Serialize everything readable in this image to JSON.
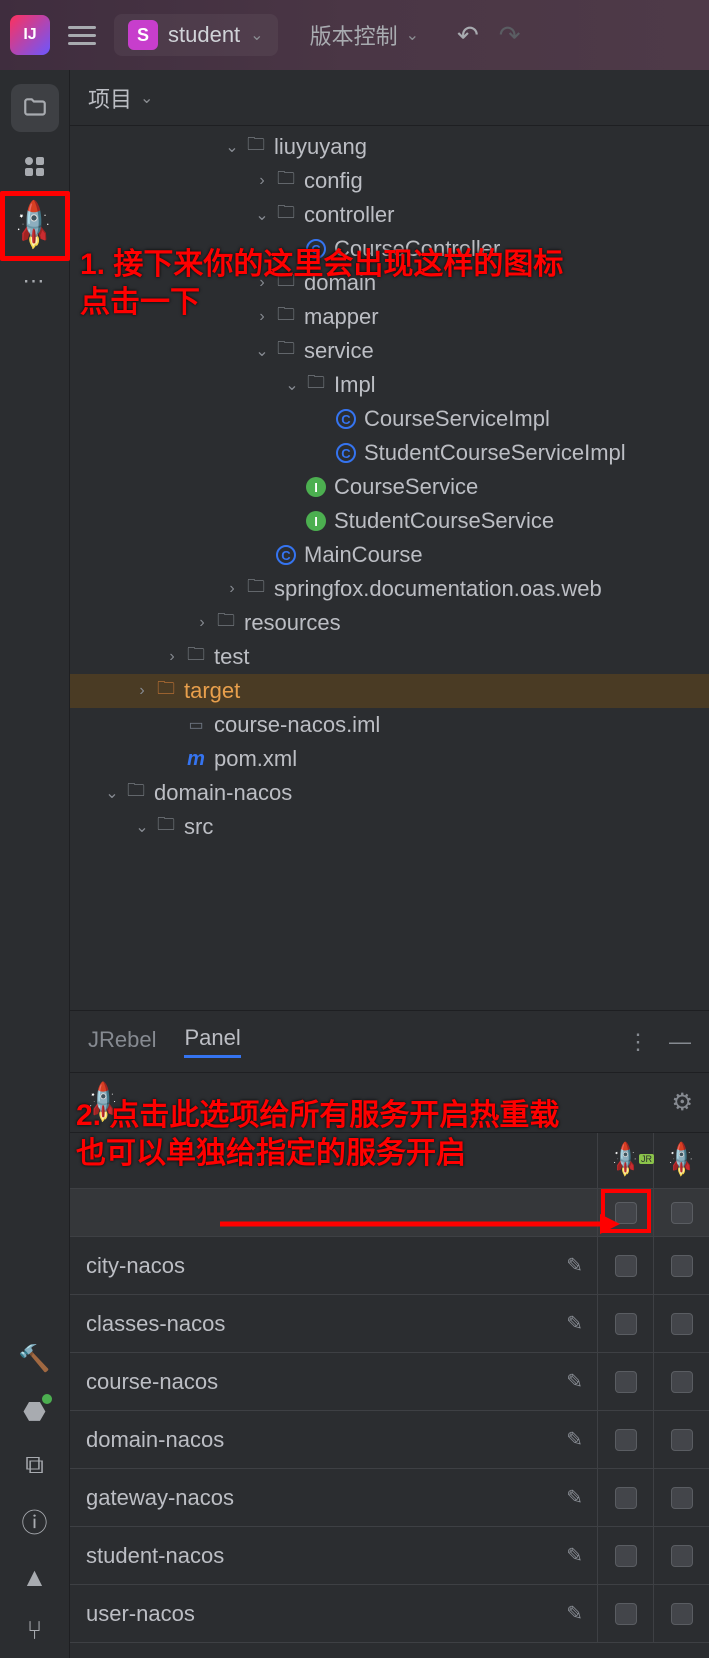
{
  "toolbar": {
    "app_badge": "IJ",
    "student_s": "S",
    "student_label": "student",
    "vcs_label": "版本控制"
  },
  "panel": {
    "project_label": "项目"
  },
  "tree": [
    {
      "indent": 5,
      "arrow": "down",
      "icon": "folder",
      "label": "liuyuyang"
    },
    {
      "indent": 6,
      "arrow": "right",
      "icon": "folder",
      "label": "config"
    },
    {
      "indent": 6,
      "arrow": "down",
      "icon": "folder",
      "label": "controller"
    },
    {
      "indent": 7,
      "arrow": "",
      "icon": "class-ring",
      "label": "CourseController"
    },
    {
      "indent": 6,
      "arrow": "right",
      "icon": "folder",
      "label": "domain"
    },
    {
      "indent": 6,
      "arrow": "right",
      "icon": "folder",
      "label": "mapper"
    },
    {
      "indent": 6,
      "arrow": "down",
      "icon": "folder",
      "label": "service"
    },
    {
      "indent": 7,
      "arrow": "down",
      "icon": "folder",
      "label": "Impl"
    },
    {
      "indent": 8,
      "arrow": "",
      "icon": "class-ring",
      "label": "CourseServiceImpl"
    },
    {
      "indent": 8,
      "arrow": "",
      "icon": "class-ring",
      "label": "StudentCourseServiceImpl"
    },
    {
      "indent": 7,
      "arrow": "",
      "icon": "interface",
      "label": "CourseService"
    },
    {
      "indent": 7,
      "arrow": "",
      "icon": "interface",
      "label": "StudentCourseService"
    },
    {
      "indent": 6,
      "arrow": "",
      "icon": "class-ring",
      "label": "MainCourse"
    },
    {
      "indent": 5,
      "arrow": "right",
      "icon": "folder",
      "label": "springfox.documentation.oas.web"
    },
    {
      "indent": 4,
      "arrow": "right",
      "icon": "folder",
      "label": "resources"
    },
    {
      "indent": 3,
      "arrow": "right",
      "icon": "folder",
      "label": "test"
    },
    {
      "indent": 2,
      "arrow": "right",
      "icon": "folder-orange",
      "label": "target",
      "selected": true,
      "labelClass": "orange"
    },
    {
      "indent": 3,
      "arrow": "",
      "icon": "file",
      "label": "course-nacos.iml"
    },
    {
      "indent": 3,
      "arrow": "",
      "icon": "m",
      "label": "pom.xml"
    },
    {
      "indent": 1,
      "arrow": "down",
      "icon": "folder",
      "label": "domain-nacos"
    },
    {
      "indent": 2,
      "arrow": "down",
      "icon": "folder",
      "label": "src"
    }
  ],
  "annotations": {
    "a1_line1": "1. 接下来你的这里会出现这样的图标",
    "a1_line2": "点击一下",
    "a2_line1": "2. 点击此选项给所有服务开启热重载",
    "a2_line2": "也可以单独给指定的服务开启"
  },
  "jrebel": {
    "tab1": "JRebel",
    "tab2": "Panel",
    "rows": [
      "city-nacos",
      "classes-nacos",
      "course-nacos",
      "domain-nacos",
      "gateway-nacos",
      "student-nacos",
      "user-nacos"
    ]
  }
}
